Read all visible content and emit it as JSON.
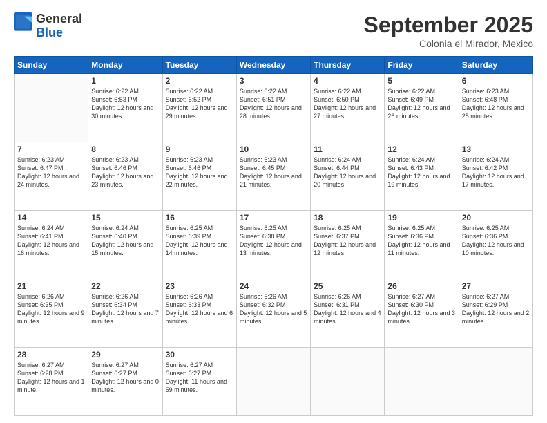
{
  "header": {
    "logo": {
      "general": "General",
      "blue": "Blue"
    },
    "title": "September 2025",
    "location": "Colonia el Mirador, Mexico"
  },
  "weekdays": [
    "Sunday",
    "Monday",
    "Tuesday",
    "Wednesday",
    "Thursday",
    "Friday",
    "Saturday"
  ],
  "weeks": [
    [
      {
        "day": "",
        "info": ""
      },
      {
        "day": "1",
        "info": "Sunrise: 6:22 AM\nSunset: 6:53 PM\nDaylight: 12 hours\nand 30 minutes."
      },
      {
        "day": "2",
        "info": "Sunrise: 6:22 AM\nSunset: 6:52 PM\nDaylight: 12 hours\nand 29 minutes."
      },
      {
        "day": "3",
        "info": "Sunrise: 6:22 AM\nSunset: 6:51 PM\nDaylight: 12 hours\nand 28 minutes."
      },
      {
        "day": "4",
        "info": "Sunrise: 6:22 AM\nSunset: 6:50 PM\nDaylight: 12 hours\nand 27 minutes."
      },
      {
        "day": "5",
        "info": "Sunrise: 6:22 AM\nSunset: 6:49 PM\nDaylight: 12 hours\nand 26 minutes."
      },
      {
        "day": "6",
        "info": "Sunrise: 6:23 AM\nSunset: 6:48 PM\nDaylight: 12 hours\nand 25 minutes."
      }
    ],
    [
      {
        "day": "7",
        "info": "Sunrise: 6:23 AM\nSunset: 6:47 PM\nDaylight: 12 hours\nand 24 minutes."
      },
      {
        "day": "8",
        "info": "Sunrise: 6:23 AM\nSunset: 6:46 PM\nDaylight: 12 hours\nand 23 minutes."
      },
      {
        "day": "9",
        "info": "Sunrise: 6:23 AM\nSunset: 6:46 PM\nDaylight: 12 hours\nand 22 minutes."
      },
      {
        "day": "10",
        "info": "Sunrise: 6:23 AM\nSunset: 6:45 PM\nDaylight: 12 hours\nand 21 minutes."
      },
      {
        "day": "11",
        "info": "Sunrise: 6:24 AM\nSunset: 6:44 PM\nDaylight: 12 hours\nand 20 minutes."
      },
      {
        "day": "12",
        "info": "Sunrise: 6:24 AM\nSunset: 6:43 PM\nDaylight: 12 hours\nand 19 minutes."
      },
      {
        "day": "13",
        "info": "Sunrise: 6:24 AM\nSunset: 6:42 PM\nDaylight: 12 hours\nand 17 minutes."
      }
    ],
    [
      {
        "day": "14",
        "info": "Sunrise: 6:24 AM\nSunset: 6:41 PM\nDaylight: 12 hours\nand 16 minutes."
      },
      {
        "day": "15",
        "info": "Sunrise: 6:24 AM\nSunset: 6:40 PM\nDaylight: 12 hours\nand 15 minutes."
      },
      {
        "day": "16",
        "info": "Sunrise: 6:25 AM\nSunset: 6:39 PM\nDaylight: 12 hours\nand 14 minutes."
      },
      {
        "day": "17",
        "info": "Sunrise: 6:25 AM\nSunset: 6:38 PM\nDaylight: 12 hours\nand 13 minutes."
      },
      {
        "day": "18",
        "info": "Sunrise: 6:25 AM\nSunset: 6:37 PM\nDaylight: 12 hours\nand 12 minutes."
      },
      {
        "day": "19",
        "info": "Sunrise: 6:25 AM\nSunset: 6:36 PM\nDaylight: 12 hours\nand 11 minutes."
      },
      {
        "day": "20",
        "info": "Sunrise: 6:25 AM\nSunset: 6:36 PM\nDaylight: 12 hours\nand 10 minutes."
      }
    ],
    [
      {
        "day": "21",
        "info": "Sunrise: 6:26 AM\nSunset: 6:35 PM\nDaylight: 12 hours\nand 9 minutes."
      },
      {
        "day": "22",
        "info": "Sunrise: 6:26 AM\nSunset: 6:34 PM\nDaylight: 12 hours\nand 7 minutes."
      },
      {
        "day": "23",
        "info": "Sunrise: 6:26 AM\nSunset: 6:33 PM\nDaylight: 12 hours\nand 6 minutes."
      },
      {
        "day": "24",
        "info": "Sunrise: 6:26 AM\nSunset: 6:32 PM\nDaylight: 12 hours\nand 5 minutes."
      },
      {
        "day": "25",
        "info": "Sunrise: 6:26 AM\nSunset: 6:31 PM\nDaylight: 12 hours\nand 4 minutes."
      },
      {
        "day": "26",
        "info": "Sunrise: 6:27 AM\nSunset: 6:30 PM\nDaylight: 12 hours\nand 3 minutes."
      },
      {
        "day": "27",
        "info": "Sunrise: 6:27 AM\nSunset: 6:29 PM\nDaylight: 12 hours\nand 2 minutes."
      }
    ],
    [
      {
        "day": "28",
        "info": "Sunrise: 6:27 AM\nSunset: 6:28 PM\nDaylight: 12 hours\nand 1 minute."
      },
      {
        "day": "29",
        "info": "Sunrise: 6:27 AM\nSunset: 6:27 PM\nDaylight: 12 hours\nand 0 minutes."
      },
      {
        "day": "30",
        "info": "Sunrise: 6:27 AM\nSunset: 6:27 PM\nDaylight: 11 hours\nand 59 minutes."
      },
      {
        "day": "",
        "info": ""
      },
      {
        "day": "",
        "info": ""
      },
      {
        "day": "",
        "info": ""
      },
      {
        "day": "",
        "info": ""
      }
    ]
  ]
}
